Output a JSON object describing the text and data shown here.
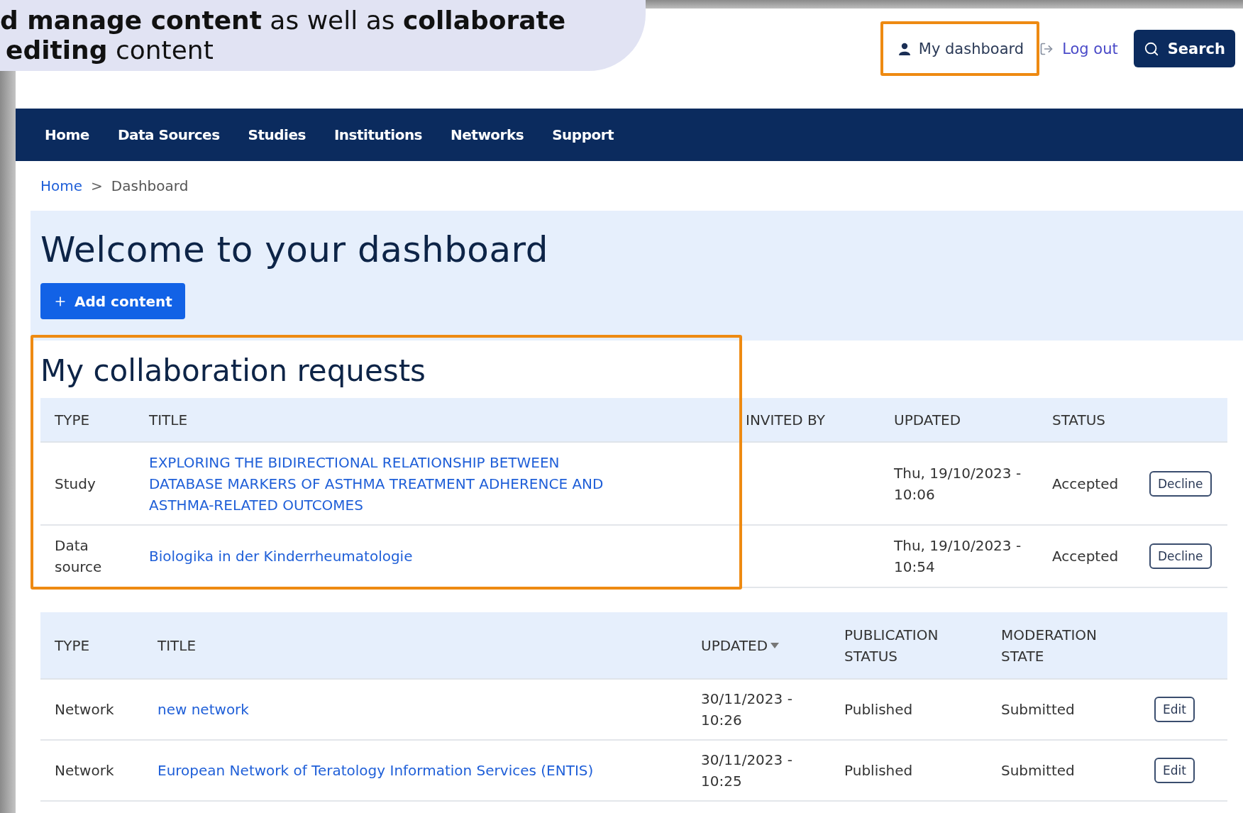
{
  "callout": {
    "lines": [
      "**d manage content** as well as **collaborate**",
      "**editing** content"
    ]
  },
  "header": {
    "links": [
      {
        "kind": "user",
        "label": "My dashboard",
        "highlighted": true
      },
      {
        "kind": "logout",
        "label": "Log out",
        "highlighted": false
      }
    ],
    "search_button": "Search"
  },
  "nav": {
    "items": [
      "Home",
      "Data Sources",
      "Studies",
      "Institutions",
      "Networks",
      "Support"
    ]
  },
  "breadcrumb": {
    "separator": ">",
    "items": [
      {
        "label": "Home",
        "link": true
      },
      {
        "label": "Dashboard",
        "link": false
      }
    ]
  },
  "welcome": {
    "title": "Welcome to your dashboard",
    "add_button": "Add content"
  },
  "collaboration_requests": {
    "title": "My collaboration requests",
    "highlighted": true,
    "columns": [
      "TYPE",
      "TITLE",
      "INVITED BY",
      "UPDATED",
      "STATUS"
    ],
    "rows": [
      {
        "type": "Study",
        "title": "EXPLORING THE BIDIRECTIONAL RELATIONSHIP BETWEEN DATABASE MARKERS OF ASTHMA TREATMENT ADHERENCE AND ASTHMA-RELATED OUTCOMES",
        "updated": "Thu, 19/10/2023 - 10:06",
        "status": "Accepted",
        "action": "Decline"
      },
      {
        "type": "Data source",
        "title": "Biologika in der Kinderrheumatologie",
        "updated": "Thu, 19/10/2023 - 10:54",
        "status": "Accepted",
        "action": "Decline"
      }
    ]
  },
  "content_table": {
    "columns": [
      {
        "label": "TYPE",
        "sorted": false
      },
      {
        "label": "TITLE",
        "sorted": false
      },
      {
        "label": "UPDATED",
        "sorted": true
      },
      {
        "label": "PUBLICATION STATUS",
        "sorted": false
      },
      {
        "label": "MODERATION STATE",
        "sorted": false
      }
    ],
    "rows": [
      {
        "type": "Network",
        "title": "new network",
        "updated": "30/11/2023 - 10:26",
        "publication_status": "Published",
        "moderation_state": "Submitted",
        "action": "Edit"
      },
      {
        "type": "Network",
        "title": "European Network of Teratology Information Services (ENTIS)",
        "updated": "30/11/2023 - 10:25",
        "publication_status": "Published",
        "moderation_state": "Submitted",
        "action": "Edit"
      }
    ]
  }
}
